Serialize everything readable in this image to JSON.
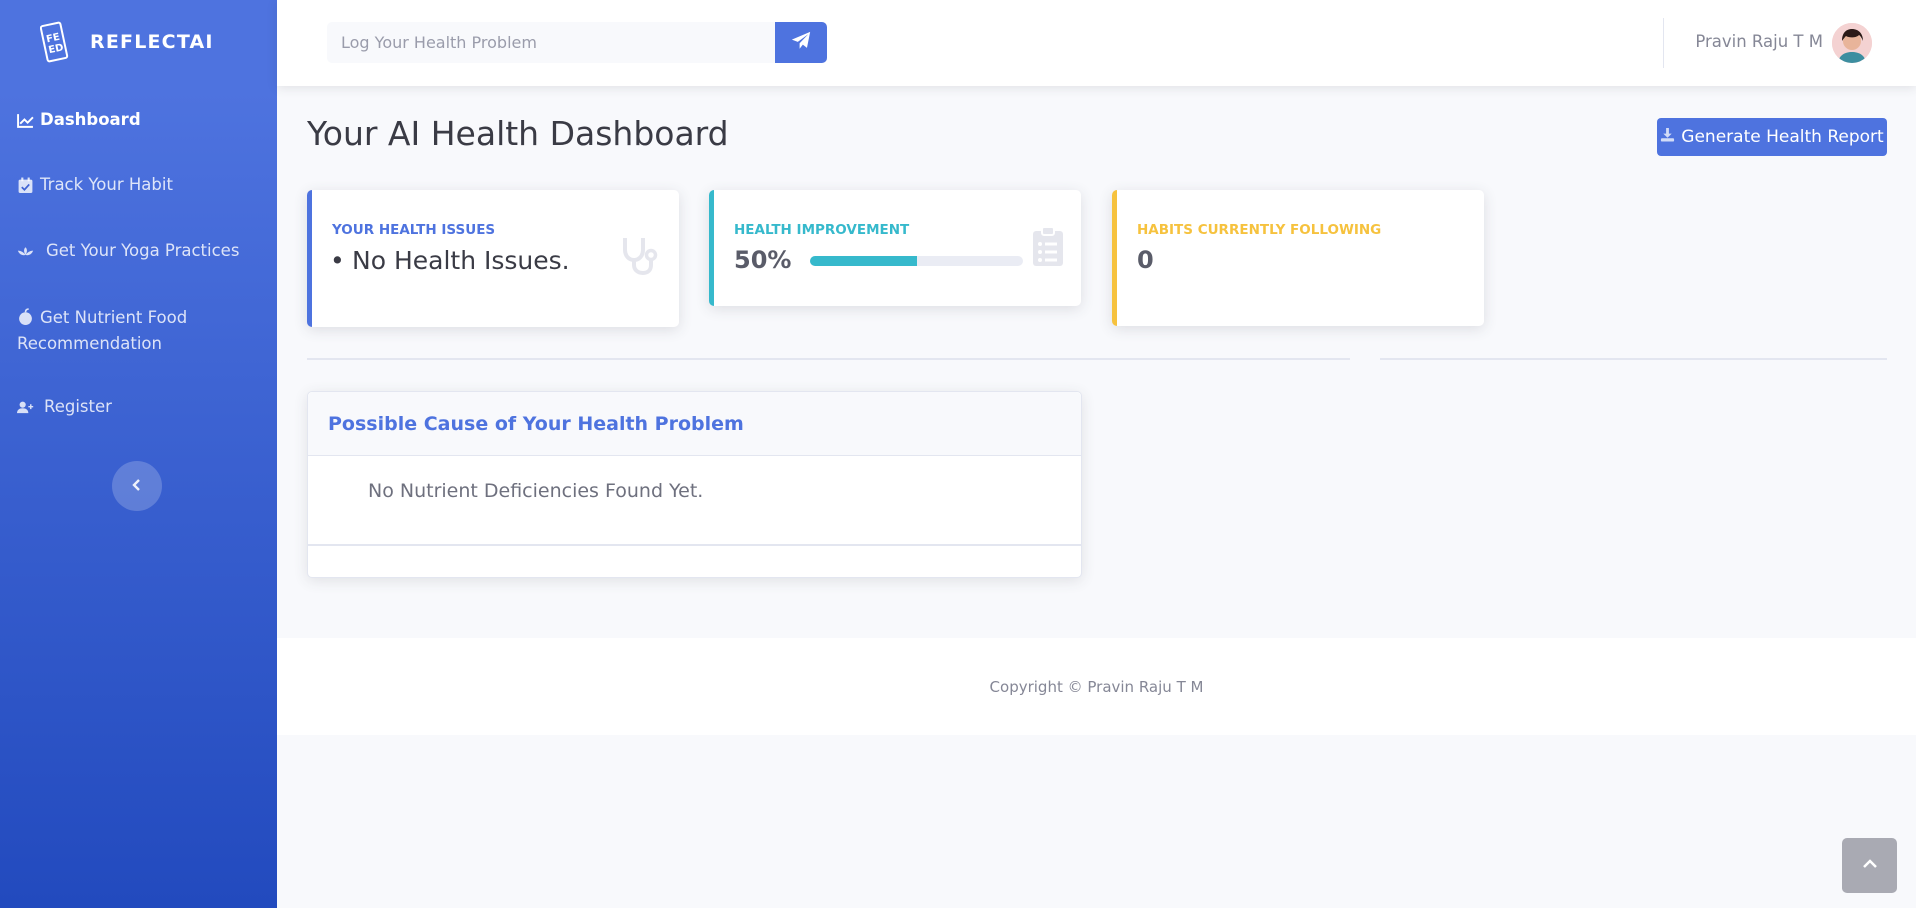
{
  "sidebar": {
    "brand": "REFLECTAI",
    "logo_text": "FE ED",
    "items": [
      {
        "label": "Dashboard",
        "icon": "chart-area-icon"
      },
      {
        "label": "Track Your Habit",
        "icon": "calendar-check-icon"
      },
      {
        "label": "Get Your Yoga Practices",
        "icon": "spa-icon"
      },
      {
        "label": "Get Nutrient Food Recommendation",
        "icon": "apple-icon"
      },
      {
        "label": "Register",
        "icon": "user-plus-icon"
      }
    ],
    "toggle_icon": "chevron-left-icon"
  },
  "topbar": {
    "search_placeholder": "Log Your Health Problem",
    "send_icon": "paper-plane-icon",
    "user_name": "Pravin Raju T M"
  },
  "main": {
    "title": "Your AI Health Dashboard",
    "report_button": "Generate Health Report",
    "cards": {
      "health_issues": {
        "label": "YOUR HEALTH ISSUES",
        "items": [
          "No Health Issues."
        ],
        "icon": "stethoscope-icon"
      },
      "health_improvement": {
        "label": "HEALTH IMPROVEMENT",
        "value": "50%",
        "progress_fraction": 0.5,
        "icon": "clipboard-list-icon"
      },
      "habits": {
        "label": "HABITS CURRENTLY FOLLOWING",
        "value": "0"
      }
    },
    "cause": {
      "title": "Possible Cause of Your Health Problem",
      "body": "No Nutrient Deficiencies Found Yet."
    }
  },
  "footer": {
    "copyright": "Copyright © Pravin Raju T M"
  },
  "colors": {
    "primary": "#4e73df",
    "info": "#36b9cc",
    "warning": "#f6c23e"
  }
}
